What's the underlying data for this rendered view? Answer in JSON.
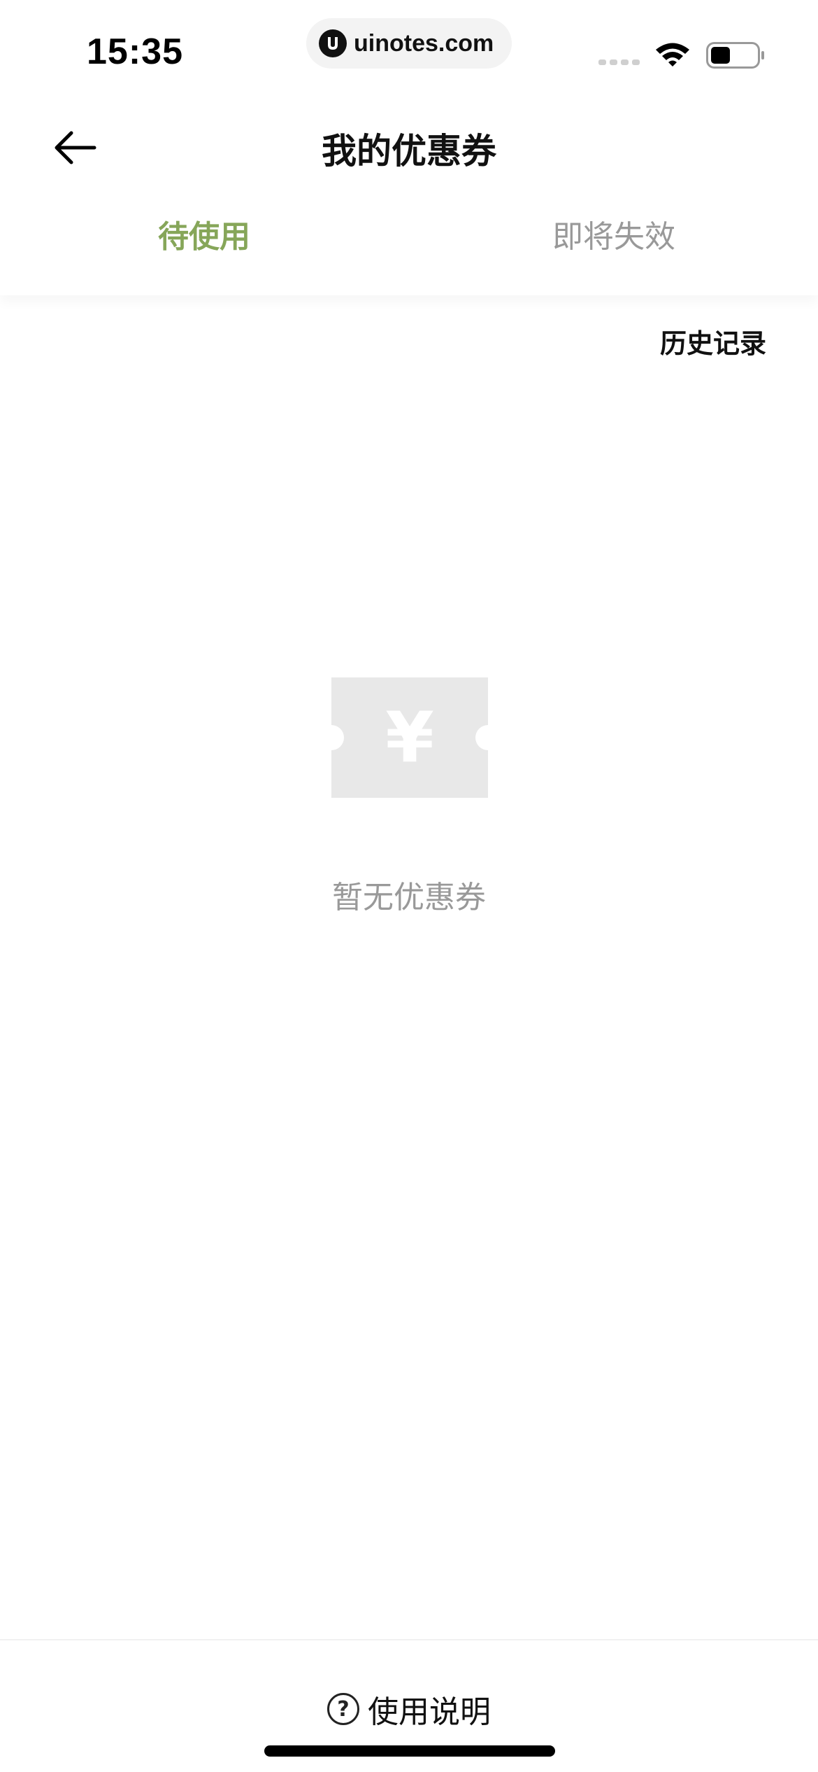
{
  "status_bar": {
    "time": "15:35",
    "url": "uinotes.com",
    "icons": [
      "cellular-signal-icon",
      "wifi-icon",
      "battery-icon"
    ]
  },
  "header": {
    "back_icon": "arrow-left-icon",
    "title": "我的优惠券",
    "tabs": [
      {
        "label": "待使用",
        "active": true
      },
      {
        "label": "即将失效",
        "active": false
      }
    ]
  },
  "history_link": "历史记录",
  "empty_state": {
    "icon": "coupon-yen-icon",
    "currency_symbol": "¥",
    "text": "暂无优惠券"
  },
  "footer": {
    "help_icon": "question-circle-icon",
    "help_symbol": "?",
    "help_label": "使用说明"
  },
  "colors": {
    "active_tab": "#86a659",
    "inactive_text": "#999999",
    "placeholder_icon": "#e8e8e8"
  }
}
